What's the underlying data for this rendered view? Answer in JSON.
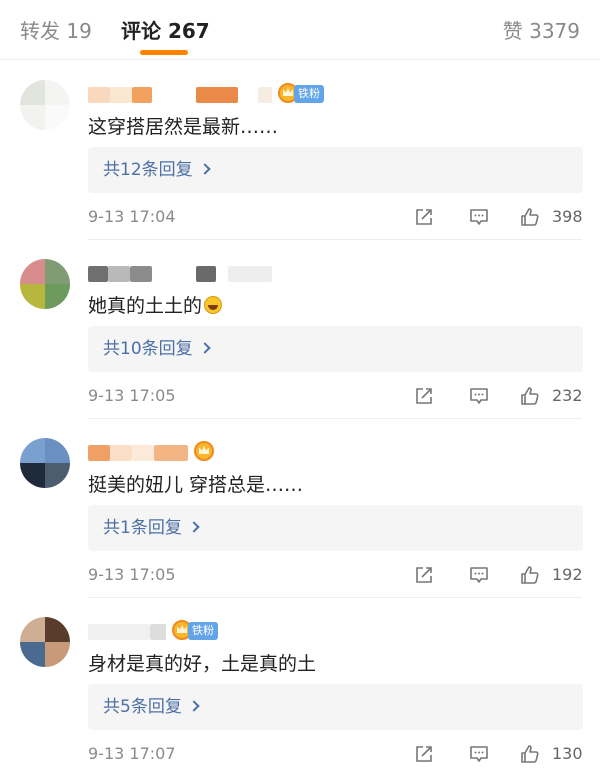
{
  "tabs": {
    "repost": "转发 19",
    "comments": "评论 267",
    "likes": "赞 3379"
  },
  "colors": {
    "accent": "#ff8200",
    "link": "#4c70a6",
    "fan_badge": "#63a4e8"
  },
  "comments": [
    {
      "text": "这穿搭居然是最新……",
      "fan_badge": "铁粉",
      "reply_label": "共12条回复",
      "timestamp": "9-13 17:04",
      "likes": "398"
    },
    {
      "text": "她真的土土的",
      "emoji": "laughing-tears-emoji",
      "reply_label": "共10条回复",
      "timestamp": "9-13 17:05",
      "likes": "232"
    },
    {
      "text": "挺美的妞儿 穿搭总是……",
      "reply_label": "共1条回复",
      "timestamp": "9-13 17:05",
      "likes": "192"
    },
    {
      "text": "身材是真的好，土是真的土",
      "fan_badge": "铁粉",
      "reply_label": "共5条回复",
      "timestamp": "9-13 17:07",
      "likes": "130"
    }
  ],
  "icons": [
    "share-icon",
    "comment-icon",
    "like-icon",
    "chevron-right-icon",
    "crown-icon"
  ]
}
